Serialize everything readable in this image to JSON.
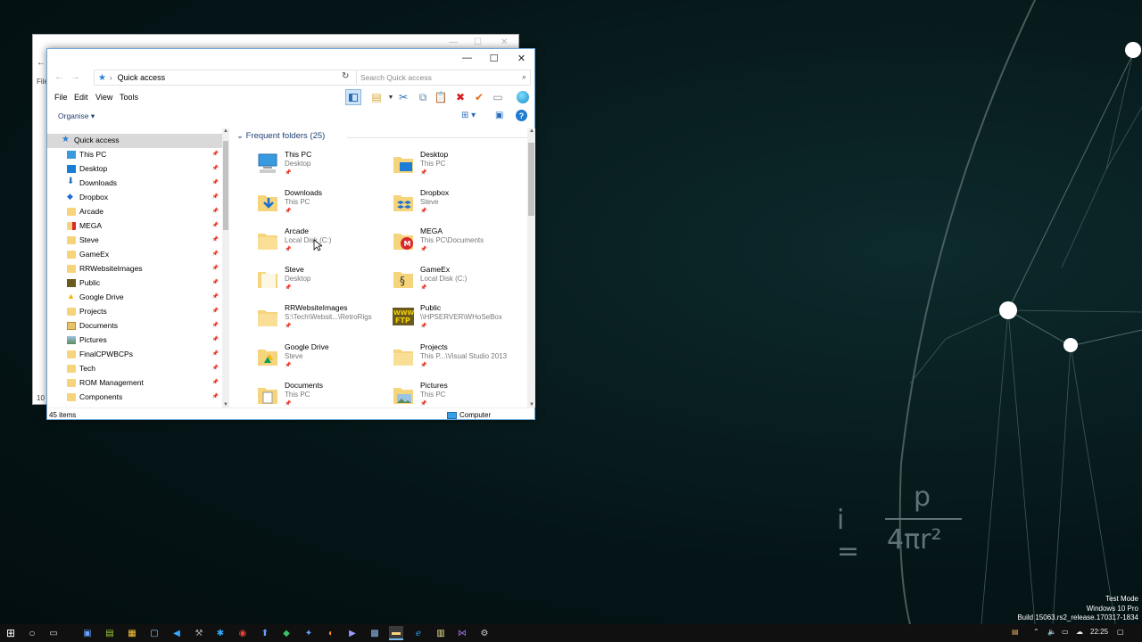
{
  "window": {
    "controls": {
      "minimize": "—",
      "maximize": "☐",
      "close": "✕"
    }
  },
  "address": {
    "path": "Quick access",
    "search_placeholder": "Search Quick access"
  },
  "menu": [
    "File",
    "Edit",
    "View",
    "Tools"
  ],
  "organise": "Organise",
  "nav": {
    "items": [
      {
        "label": "Quick access",
        "icon": "star-icon",
        "color": "#2a7fd4"
      },
      {
        "label": "This PC",
        "icon": "computer-icon",
        "color": "#3a9ae0"
      },
      {
        "label": "Desktop",
        "icon": "desktop-icon",
        "color": "#1a7dd6"
      },
      {
        "label": "Downloads",
        "icon": "download-arrow-icon",
        "color": "#2a6ebb"
      },
      {
        "label": "Dropbox",
        "icon": "dropbox-icon",
        "color": "#1f6fd1"
      },
      {
        "label": "Arcade",
        "icon": "folder-icon",
        "color": "#f6d47c"
      },
      {
        "label": "MEGA",
        "icon": "mega-icon",
        "color": "#d9272e"
      },
      {
        "label": "Steve",
        "icon": "folder-icon",
        "color": "#f6d47c"
      },
      {
        "label": "GameEx",
        "icon": "folder-icon",
        "color": "#f6d47c"
      },
      {
        "label": "RRWebsiteImages",
        "icon": "folder-icon",
        "color": "#f6d47c"
      },
      {
        "label": "Public",
        "icon": "ftp-icon",
        "color": "#6b5a1e"
      },
      {
        "label": "Google Drive",
        "icon": "google-drive-icon",
        "color": "#f4b400"
      },
      {
        "label": "Projects",
        "icon": "folder-icon",
        "color": "#f6d47c"
      },
      {
        "label": "Documents",
        "icon": "documents-icon",
        "color": "#e7c36a"
      },
      {
        "label": "Pictures",
        "icon": "pictures-icon",
        "color": "#e7c36a"
      },
      {
        "label": "FinalCPWBCPs",
        "icon": "folder-icon",
        "color": "#f6d47c"
      },
      {
        "label": "Tech",
        "icon": "folder-icon",
        "color": "#f6d47c"
      },
      {
        "label": "ROM Management",
        "icon": "folder-icon",
        "color": "#f6d47c"
      },
      {
        "label": "Components",
        "icon": "folder-icon",
        "color": "#f6d47c"
      }
    ]
  },
  "content": {
    "group_title": "Frequent folders (25)",
    "tiles": [
      {
        "name": "This PC",
        "sub": "Desktop",
        "icon": "computer-icon"
      },
      {
        "name": "Desktop",
        "sub": "This PC",
        "icon": "desktop-folder-icon"
      },
      {
        "name": "Downloads",
        "sub": "This PC",
        "icon": "downloads-folder-icon"
      },
      {
        "name": "Dropbox",
        "sub": "Steve",
        "icon": "dropbox-folder-icon"
      },
      {
        "name": "Arcade",
        "sub": "Local Disk (C:)",
        "icon": "folder-icon"
      },
      {
        "name": "MEGA",
        "sub": "This PC\\Documents",
        "icon": "mega-folder-icon"
      },
      {
        "name": "Steve",
        "sub": "Desktop",
        "icon": "folder-icon"
      },
      {
        "name": "GameEx",
        "sub": "Local Disk (C:)",
        "icon": "gameex-folder-icon"
      },
      {
        "name": "RRWebsiteImages",
        "sub": "S:\\Tech\\Websit...\\RetroRigs",
        "icon": "folder-icon"
      },
      {
        "name": "Public",
        "sub": "\\\\HPSERVER\\WHoSeBox",
        "icon": "ftp-folder-icon"
      },
      {
        "name": "Google Drive",
        "sub": "Steve",
        "icon": "google-drive-folder-icon"
      },
      {
        "name": "Projects",
        "sub": "This P...\\Visual Studio 2013",
        "icon": "folder-icon"
      },
      {
        "name": "Documents",
        "sub": "This PC",
        "icon": "documents-folder-icon"
      },
      {
        "name": "Pictures",
        "sub": "This PC",
        "icon": "pictures-folder-icon"
      }
    ]
  },
  "status": {
    "items": "45 items",
    "location": "Computer"
  },
  "back_window": {
    "side_a": "File",
    "side_b": "10 it"
  },
  "watermark": {
    "line1": "Test Mode",
    "line2": "Windows 10 Pro",
    "line3": "Build 15063.rs2_release.170317-1834"
  },
  "wallpaper_formula": {
    "lhs": "i =",
    "numerator": "p",
    "denominator": "4πr²"
  },
  "tray": {
    "time": "22:25"
  },
  "colors": {
    "accent": "#1f7ad1",
    "folder": "#f6d47c",
    "desktop_bg": "#051517"
  }
}
